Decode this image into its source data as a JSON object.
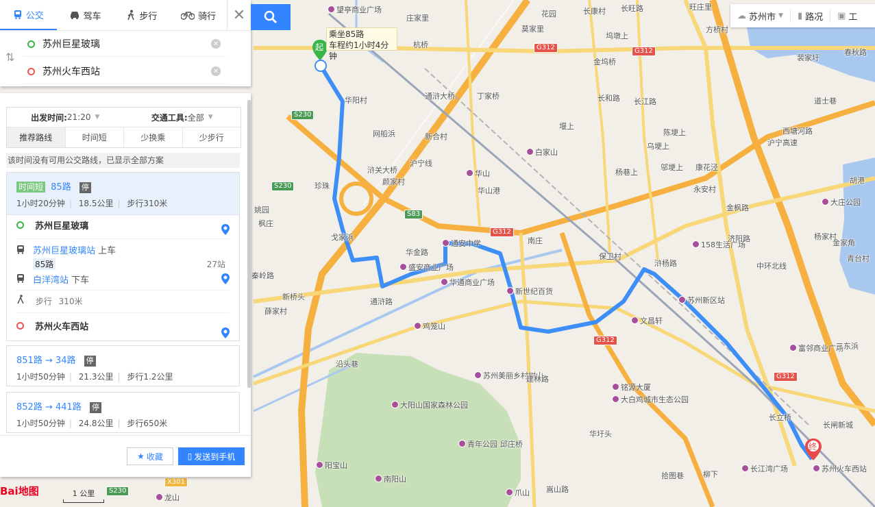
{
  "colors": {
    "accent": "#3385ff",
    "route": "#3e8ef7",
    "start": "#39b54a",
    "end": "#e55"
  },
  "modes": [
    {
      "label": "公交",
      "icon": "bus-icon",
      "active": true
    },
    {
      "label": "驾车",
      "icon": "car-icon"
    },
    {
      "label": "步行",
      "icon": "walk-icon"
    },
    {
      "label": "骑行",
      "icon": "bike-icon"
    }
  ],
  "search": {
    "from": "苏州巨星玻璃",
    "to": "苏州火车西站"
  },
  "filters": {
    "depart_label": "出发时间:",
    "depart_value": "21:20",
    "transport_label": "交通工具:",
    "transport_value": "全部",
    "sort_tabs": [
      "推荐路线",
      "时间短",
      "少换乘",
      "少步行"
    ]
  },
  "notice": "该时间没有可用公交路线，已显示全部方案",
  "routes": [
    {
      "tag": "时间短",
      "title": "85路",
      "stop_tag": "停",
      "duration": "1小时20分钟",
      "distance": "18.5公里",
      "walk": "步行310米",
      "steps": {
        "origin": "苏州巨星玻璃",
        "board_stop": "苏州巨星玻璃站",
        "board_action": "上车",
        "line": "85路",
        "stop_count": "27站",
        "alight_stop": "白洋湾站",
        "alight_action": "下车",
        "walk_text": "步行",
        "walk_dist": "310米",
        "destination": "苏州火车西站"
      }
    },
    {
      "title": "851路 → 34路",
      "stop_tag": "停",
      "duration": "1小时50分钟",
      "distance": "21.3公里",
      "walk": "步行1.2公里"
    },
    {
      "title": "852路 → 441路",
      "stop_tag": "停",
      "duration": "1小时50分钟",
      "distance": "24.8公里",
      "walk": "步行650米"
    }
  ],
  "footer": {
    "favorite": "收藏",
    "send": "发送到手机"
  },
  "toolbar": {
    "city": "苏州市",
    "traffic": "路况",
    "tools": "工"
  },
  "callout": {
    "line1": "乘坐85路",
    "line2": "车程约1小时4分钟"
  },
  "markers": {
    "start": "起",
    "end": "终"
  },
  "logo": "Bai地图",
  "scale": "1 公里",
  "map_labels": [
    "望亭商业广场",
    "庄家里",
    "花园",
    "长康村",
    "长旺路",
    "旺庄里",
    "方桥村",
    "莫家里",
    "坞墩上",
    "杭桥",
    "金坞桥",
    "华阳村",
    "通浒大桥",
    "丁家桥",
    "长和路",
    "长江路",
    "堰上",
    "网船浜",
    "新合村",
    "白家山",
    "陈埂上",
    "乌埂上",
    "邬埂上",
    "康花泾",
    "杨巷上",
    "永安村",
    "华山",
    "华山港",
    "颜家村",
    "珍珠",
    "浒关大桥",
    "姚园",
    "沪宁线",
    "枫庄",
    "戈家浜",
    "华金路",
    "盛安商业广场",
    "通安中学",
    "华通商业广场",
    "南庄",
    "保卫村",
    "158生活广场",
    "新世纪百货",
    "苏州新区站",
    "文昌轩",
    "秦岭路",
    "新桥头",
    "薛家村",
    "通浒路",
    "鸡笼山",
    "沿头巷",
    "苏州美丽乡村树山",
    "建林路",
    "铭源大厦",
    "大白鸡城市生态公园",
    "大阳山国家森林公园",
    "青年公园",
    "邱庄桥",
    "华圩头",
    "长立桥",
    "富邻商业广场",
    "三东浜",
    "苏州火车西站",
    "长江湾广场",
    "拾图巷",
    "柳下",
    "阳宝山",
    "南阳山",
    "爪山",
    "龙山",
    "嵩山路",
    "大庄公园",
    "金家角",
    "青台村",
    "杨家村",
    "胡港",
    "道士巷",
    "西塘河路",
    "裴家圩",
    "春秋路",
    "长闸新城",
    "浒杨路",
    "金枫路",
    "济阳路",
    "中环北线",
    "沪宁高速"
  ],
  "road_shields": [
    "G312",
    "G312",
    "S230",
    "S230",
    "S83",
    "G312",
    "G312",
    "G312",
    "X301",
    "S230"
  ]
}
